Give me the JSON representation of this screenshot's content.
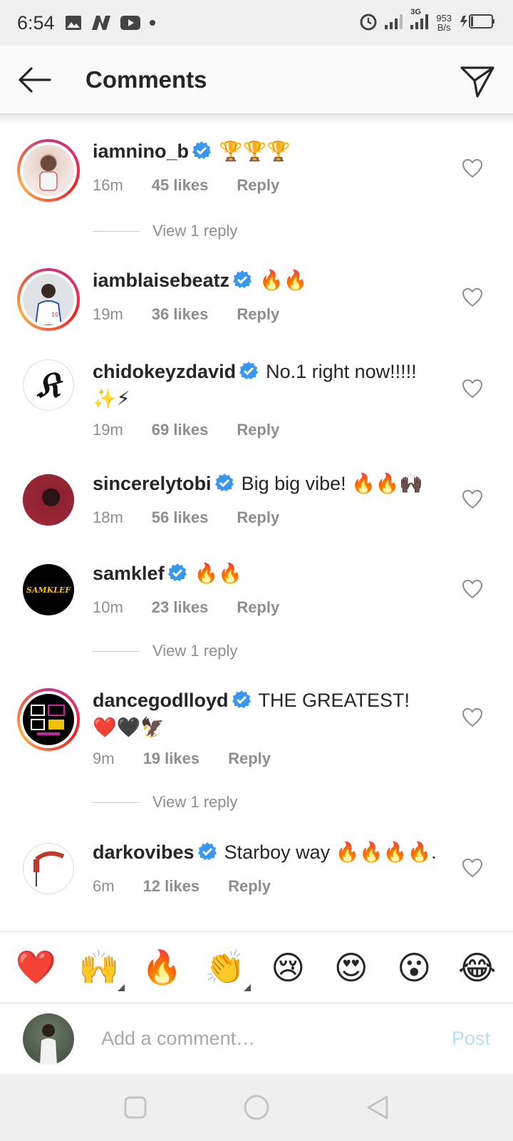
{
  "status_bar": {
    "time": "6:54",
    "network_speed_value": "953",
    "network_speed_unit": "B/s",
    "network_type": "3G"
  },
  "header": {
    "title": "Comments"
  },
  "comments": [
    {
      "username": "iamnino_b",
      "text": "🏆🏆🏆",
      "time": "16m",
      "likes": "45 likes",
      "reply_label": "Reply",
      "story_ring": true
    },
    {
      "username": "iamblaisebeatz",
      "text": "🔥🔥",
      "time": "19m",
      "likes": "36 likes",
      "reply_label": "Reply",
      "story_ring": true
    },
    {
      "username": "chidokeyzdavid",
      "text": "No.1 right now!!!!! ✨⚡",
      "time": "19m",
      "likes": "69 likes",
      "reply_label": "Reply",
      "story_ring": false
    },
    {
      "username": "sincerelytobi",
      "text": "Big big vibe! 🔥🔥🙌🏿",
      "time": "18m",
      "likes": "56 likes",
      "reply_label": "Reply",
      "story_ring": false
    },
    {
      "username": "samklef",
      "text": "🔥🔥",
      "time": "10m",
      "likes": "23 likes",
      "reply_label": "Reply",
      "story_ring": false,
      "avatar_text": "SAMKLEF"
    },
    {
      "username": "dancegodlloyd",
      "text": "THE GREATEST! ❤️🖤🦅",
      "time": "9m",
      "likes": "19 likes",
      "reply_label": "Reply",
      "story_ring": true
    },
    {
      "username": "darkovibes",
      "text": "Starboy way 🔥🔥🔥🔥.",
      "time": "6m",
      "likes": "12 likes",
      "reply_label": "Reply",
      "story_ring": false
    }
  ],
  "view_replies": {
    "label": "View 1 reply"
  },
  "emoji_bar": [
    "❤️",
    "🙌",
    "🔥",
    "👏",
    "😢",
    "😍",
    "😮",
    "😂"
  ],
  "composer": {
    "placeholder": "Add a comment…",
    "post_label": "Post"
  },
  "colors": {
    "verified": "#3897f0",
    "post_disabled": "#b2dffc",
    "meta_gray": "#8e8e8e"
  }
}
